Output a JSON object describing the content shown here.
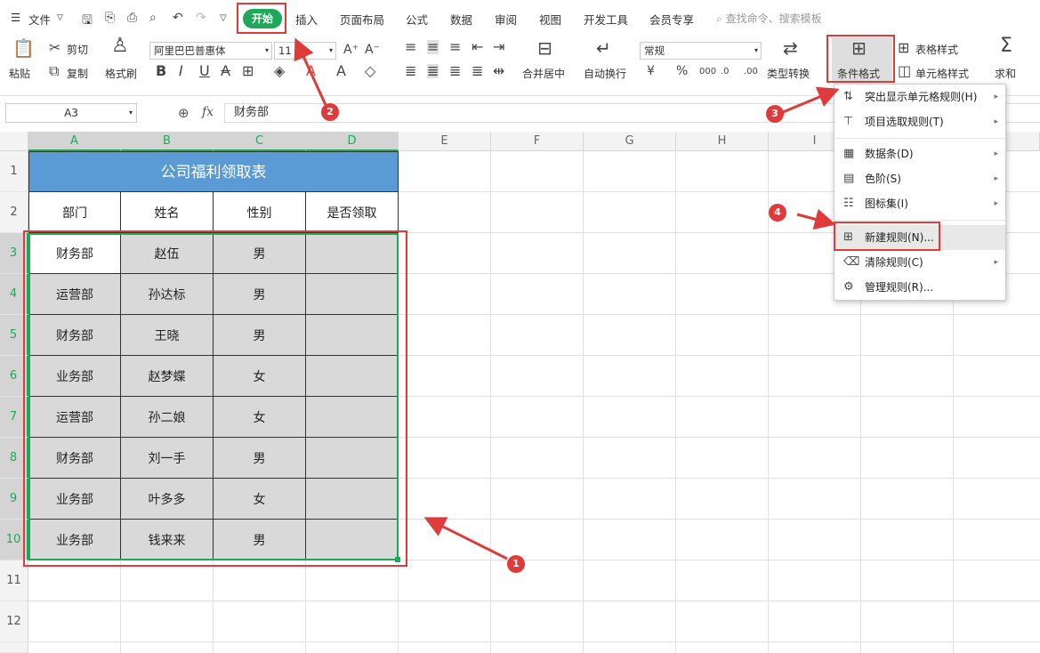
{
  "menubar": {
    "file": "文件",
    "tabs": [
      "开始",
      "插入",
      "页面布局",
      "公式",
      "数据",
      "审阅",
      "视图",
      "开发工具",
      "会员专享"
    ],
    "search": "查找命令、搜索模板"
  },
  "ribbon": {
    "paste": "粘贴",
    "cut": "剪切",
    "copy": "复制",
    "format_painter": "格式刷",
    "font": "阿里巴巴普惠体",
    "size": "11",
    "merge": "合并居中",
    "wrap": "自动换行",
    "num_format": "常规",
    "type_convert": "类型转换",
    "cond_format": "条件格式",
    "table_style": "表格样式",
    "cell_style": "单元格样式",
    "sum": "求和"
  },
  "formula": {
    "namebox": "A3",
    "fx": "fx",
    "value": "财务部"
  },
  "columns": [
    "A",
    "B",
    "C",
    "D",
    "E",
    "F",
    "G",
    "H",
    "I"
  ],
  "rows": [
    "1",
    "2",
    "3",
    "4",
    "5",
    "6",
    "7",
    "8",
    "9",
    "10",
    "11",
    "12"
  ],
  "sheet": {
    "title": "公司福利领取表",
    "headers": [
      "部门",
      "姓名",
      "性别",
      "是否领取"
    ],
    "data": [
      [
        "财务部",
        "赵伍",
        "男",
        ""
      ],
      [
        "运营部",
        "孙达标",
        "男",
        ""
      ],
      [
        "财务部",
        "王晓",
        "男",
        ""
      ],
      [
        "业务部",
        "赵梦蝶",
        "女",
        ""
      ],
      [
        "运营部",
        "孙二娘",
        "女",
        ""
      ],
      [
        "财务部",
        "刘一手",
        "男",
        ""
      ],
      [
        "业务部",
        "叶多多",
        "女",
        ""
      ],
      [
        "业务部",
        "钱来来",
        "男",
        ""
      ]
    ]
  },
  "dropdown": {
    "items": [
      "突出显示单元格规则(H)",
      "项目选取规则(T)",
      "数据条(D)",
      "色阶(S)",
      "图标集(I)",
      "新建规则(N)...",
      "清除规则(C)",
      "管理规则(R)..."
    ]
  },
  "annotations": [
    "1",
    "2",
    "3",
    "4"
  ],
  "colors": {
    "accent": "#1fa85a",
    "title_bg": "#5b9bd5",
    "highlight": "#e03b3b",
    "selection_fill": "#d9d9d9"
  }
}
